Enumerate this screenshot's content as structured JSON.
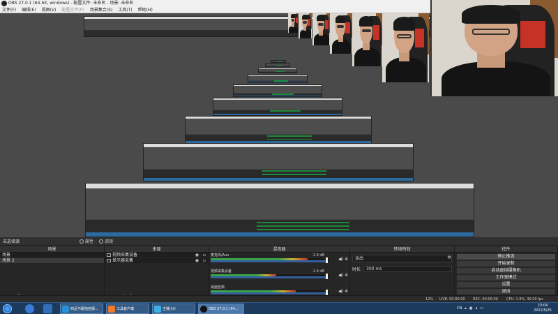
{
  "window": {
    "title": "OBS 27.0.1 (64-bit, windows) - 配置文件: 未命名 - 场景: 未命名"
  },
  "menu": {
    "items": [
      {
        "label": "文件(F)",
        "disabled": false
      },
      {
        "label": "编辑(E)",
        "disabled": false
      },
      {
        "label": "视图(V)",
        "disabled": false
      },
      {
        "label": "配置文件(P)",
        "disabled": true
      },
      {
        "label": "场景集合(S)",
        "disabled": false
      },
      {
        "label": "工具(T)",
        "disabled": false
      },
      {
        "label": "帮助(H)",
        "disabled": false
      }
    ]
  },
  "sceneBar": {
    "sceneName": "未选择源",
    "properties": "属性",
    "filters": "滤镜"
  },
  "scenes": {
    "title": "场景",
    "items": [
      "场景",
      "场景 2"
    ],
    "selected": 1
  },
  "sources": {
    "title": "来源",
    "items": [
      "视频采集设备",
      "显示器采集"
    ]
  },
  "mixer": {
    "title": "混音器",
    "channels": [
      {
        "name": "麦克风/Aux",
        "db": "-1.9 dB",
        "level": 0.82,
        "vol": 0.98
      },
      {
        "name": "视频采集设备",
        "db": "-1.9 dB",
        "level": 0.55,
        "vol": 0.98
      },
      {
        "name": "桌面音频",
        "db": "",
        "level": 0.72,
        "vol": 0.98
      }
    ]
  },
  "transitions": {
    "title": "转场特效",
    "type": "淡出",
    "durationLabel": "时长",
    "durationValue": "300 ms"
  },
  "controls": {
    "title": "控件",
    "buttons": [
      "停止推流",
      "开始录制",
      "启动虚拟摄像机",
      "工作室模式",
      "设置",
      "退出"
    ]
  },
  "status": {
    "live": "LIVE: 00:00:00",
    "rec": "REC: 00:00:00",
    "cpu": "CPU: 1.9%, 30.00 fps",
    "dropped": "12%"
  },
  "taskbar": {
    "items": [
      "商品与跟拍拍摄...",
      "工具客户端",
      "主播小U",
      "OBS 27.0.1 (64..."
    ],
    "trayLang": "CN",
    "time": "23:04",
    "date": "2022/5/25"
  },
  "colors": {
    "accent": "#2c6aa0",
    "meterGreen": "#3aa24a",
    "meterYellow": "#c9b12b",
    "meterRed": "#b83030",
    "meterBlue": "#355e9c",
    "taskbar": "#1c3a5c"
  }
}
